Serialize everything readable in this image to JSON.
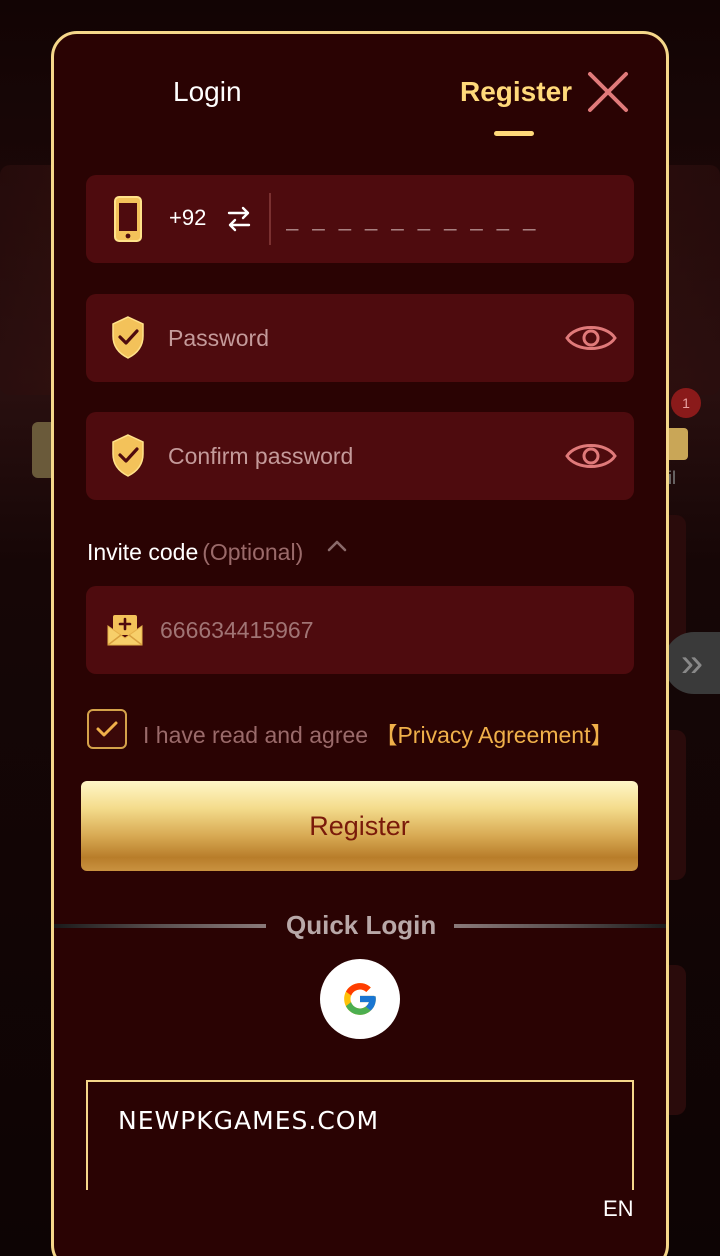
{
  "tabs": {
    "login": "Login",
    "register": "Register"
  },
  "phone": {
    "country_code": "+92",
    "placeholder": "_ _ _ _ _ _ _ _ _ _"
  },
  "password": {
    "placeholder": "Password"
  },
  "confirm_password": {
    "placeholder": "Confirm password"
  },
  "invite": {
    "label": "Invite code",
    "optional": "(Optional)",
    "placeholder": "666634415967"
  },
  "agreement": {
    "text": "I have read and agree",
    "link": "【Privacy Agreement】",
    "checked": true
  },
  "register_button": "Register",
  "quick_login": {
    "label": "Quick Login",
    "providers": [
      "google"
    ]
  },
  "site": {
    "domain": "NEWPKGAMES.COM"
  },
  "language": "EN",
  "background": {
    "badge_count": "1",
    "mail_label": "il"
  },
  "colors": {
    "accent_gold": "#ffd97a",
    "modal_bg": "#2a0303",
    "field_bg": "#4e0b0e",
    "link": "#f0b04a"
  }
}
